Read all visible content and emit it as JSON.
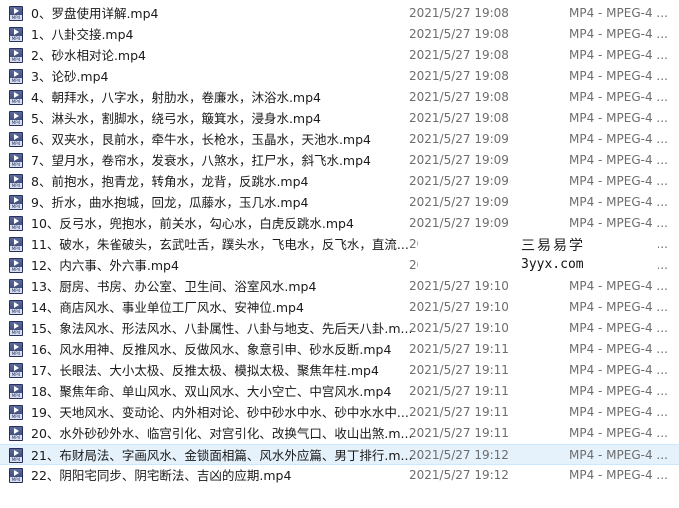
{
  "files": [
    {
      "name": "0、罗盘使用详解.mp4",
      "date": "2021/5/27 19:08",
      "type": "MP4 - MPEG-4 ..."
    },
    {
      "name": "1、八卦交接.mp4",
      "date": "2021/5/27 19:08",
      "type": "MP4 - MPEG-4 ..."
    },
    {
      "name": "2、砂水相对论.mp4",
      "date": "2021/5/27 19:08",
      "type": "MP4 - MPEG-4 ..."
    },
    {
      "name": "3、论砂.mp4",
      "date": "2021/5/27 19:08",
      "type": "MP4 - MPEG-4 ..."
    },
    {
      "name": "4、朝拜水，八字水，射肋水，卷廉水，沐浴水.mp4",
      "date": "2021/5/27 19:08",
      "type": "MP4 - MPEG-4 ..."
    },
    {
      "name": "5、淋头水，割脚水，绕弓水，簸箕水，浸身水.mp4",
      "date": "2021/5/27 19:08",
      "type": "MP4 - MPEG-4 ..."
    },
    {
      "name": "6、双夹水，艮前水，牵牛水，长枪水，玉晶水，天池水.mp4",
      "date": "2021/5/27 19:09",
      "type": "MP4 - MPEG-4 ..."
    },
    {
      "name": "7、望月水，卷帘水，发衰水，八煞水，扛尸水，斜飞水.mp4",
      "date": "2021/5/27 19:09",
      "type": "MP4 - MPEG-4 ..."
    },
    {
      "name": "8、前抱水，抱青龙，转角水，龙背，反跳水.mp4",
      "date": "2021/5/27 19:09",
      "type": "MP4 - MPEG-4 ..."
    },
    {
      "name": "9、折水，曲水抱城，回龙，瓜藤水，玉几水.mp4",
      "date": "2021/5/27 19:09",
      "type": "MP4 - MPEG-4 ..."
    },
    {
      "name": "10、反弓水，兜抱水，前关水，勾心水，白虎反跳水.mp4",
      "date": "2021/5/27 19:09",
      "type": "MP4 - MPEG-4 ..."
    },
    {
      "name": "11、破水，朱雀破头，玄武吐舌，蹼头水，飞电水，反飞水，直流...",
      "date": "20",
      "type": "MP4 - MPEG-4 ..."
    },
    {
      "name": "12、内六事、外六事.mp4",
      "date": "20",
      "type": "MP4 - MPEG-4 ..."
    },
    {
      "name": "13、厨房、书房、办公室、卫生间、浴室风水.mp4",
      "date": "2021/5/27 19:10",
      "type": "MP4 - MPEG-4 ..."
    },
    {
      "name": "14、商店风水、事业单位工厂风水、安神位.mp4",
      "date": "2021/5/27 19:10",
      "type": "MP4 - MPEG-4 ..."
    },
    {
      "name": "15、象法风水、形法风水、八卦属性、八卦与地支、先后天八卦.m...",
      "date": "2021/5/27 19:10",
      "type": "MP4 - MPEG-4 ..."
    },
    {
      "name": "16、风水用神、反推风水、反做风水、象意引申、砂水反断.mp4",
      "date": "2021/5/27 19:11",
      "type": "MP4 - MPEG-4 ..."
    },
    {
      "name": "17、长眼法、大小太极、反推太极、模拟太极、聚焦年柱.mp4",
      "date": "2021/5/27 19:11",
      "type": "MP4 - MPEG-4 ..."
    },
    {
      "name": "18、聚焦年命、单山风水、双山风水、大小空亡、中宫风水.mp4",
      "date": "2021/5/27 19:11",
      "type": "MP4 - MPEG-4 ..."
    },
    {
      "name": "19、天地风水、变动论、内外相对论、砂中砂水中水、砂中水水中...",
      "date": "2021/5/27 19:11",
      "type": "MP4 - MPEG-4 ..."
    },
    {
      "name": "20、水外砂砂外水、临宫引化、对宫引化、改换气口、收山出煞.m...",
      "date": "2021/5/27 19:11",
      "type": "MP4 - MPEG-4 ..."
    },
    {
      "name": "21、布财局法、字画风水、金锁面相篇、风水外应篇、男丁排行.m...",
      "date": "2021/5/27 19:12",
      "type": "MP4 - MPEG-4 ..."
    },
    {
      "name": "22、阴阳宅同步、阴宅断法、吉凶的应期.mp4",
      "date": "2021/5/27 19:12",
      "type": "MP4 - MPEG-4 ..."
    }
  ],
  "icon_tag": "MP4",
  "watermark": {
    "line1": "三易易学",
    "line2": "3yyx.com"
  }
}
